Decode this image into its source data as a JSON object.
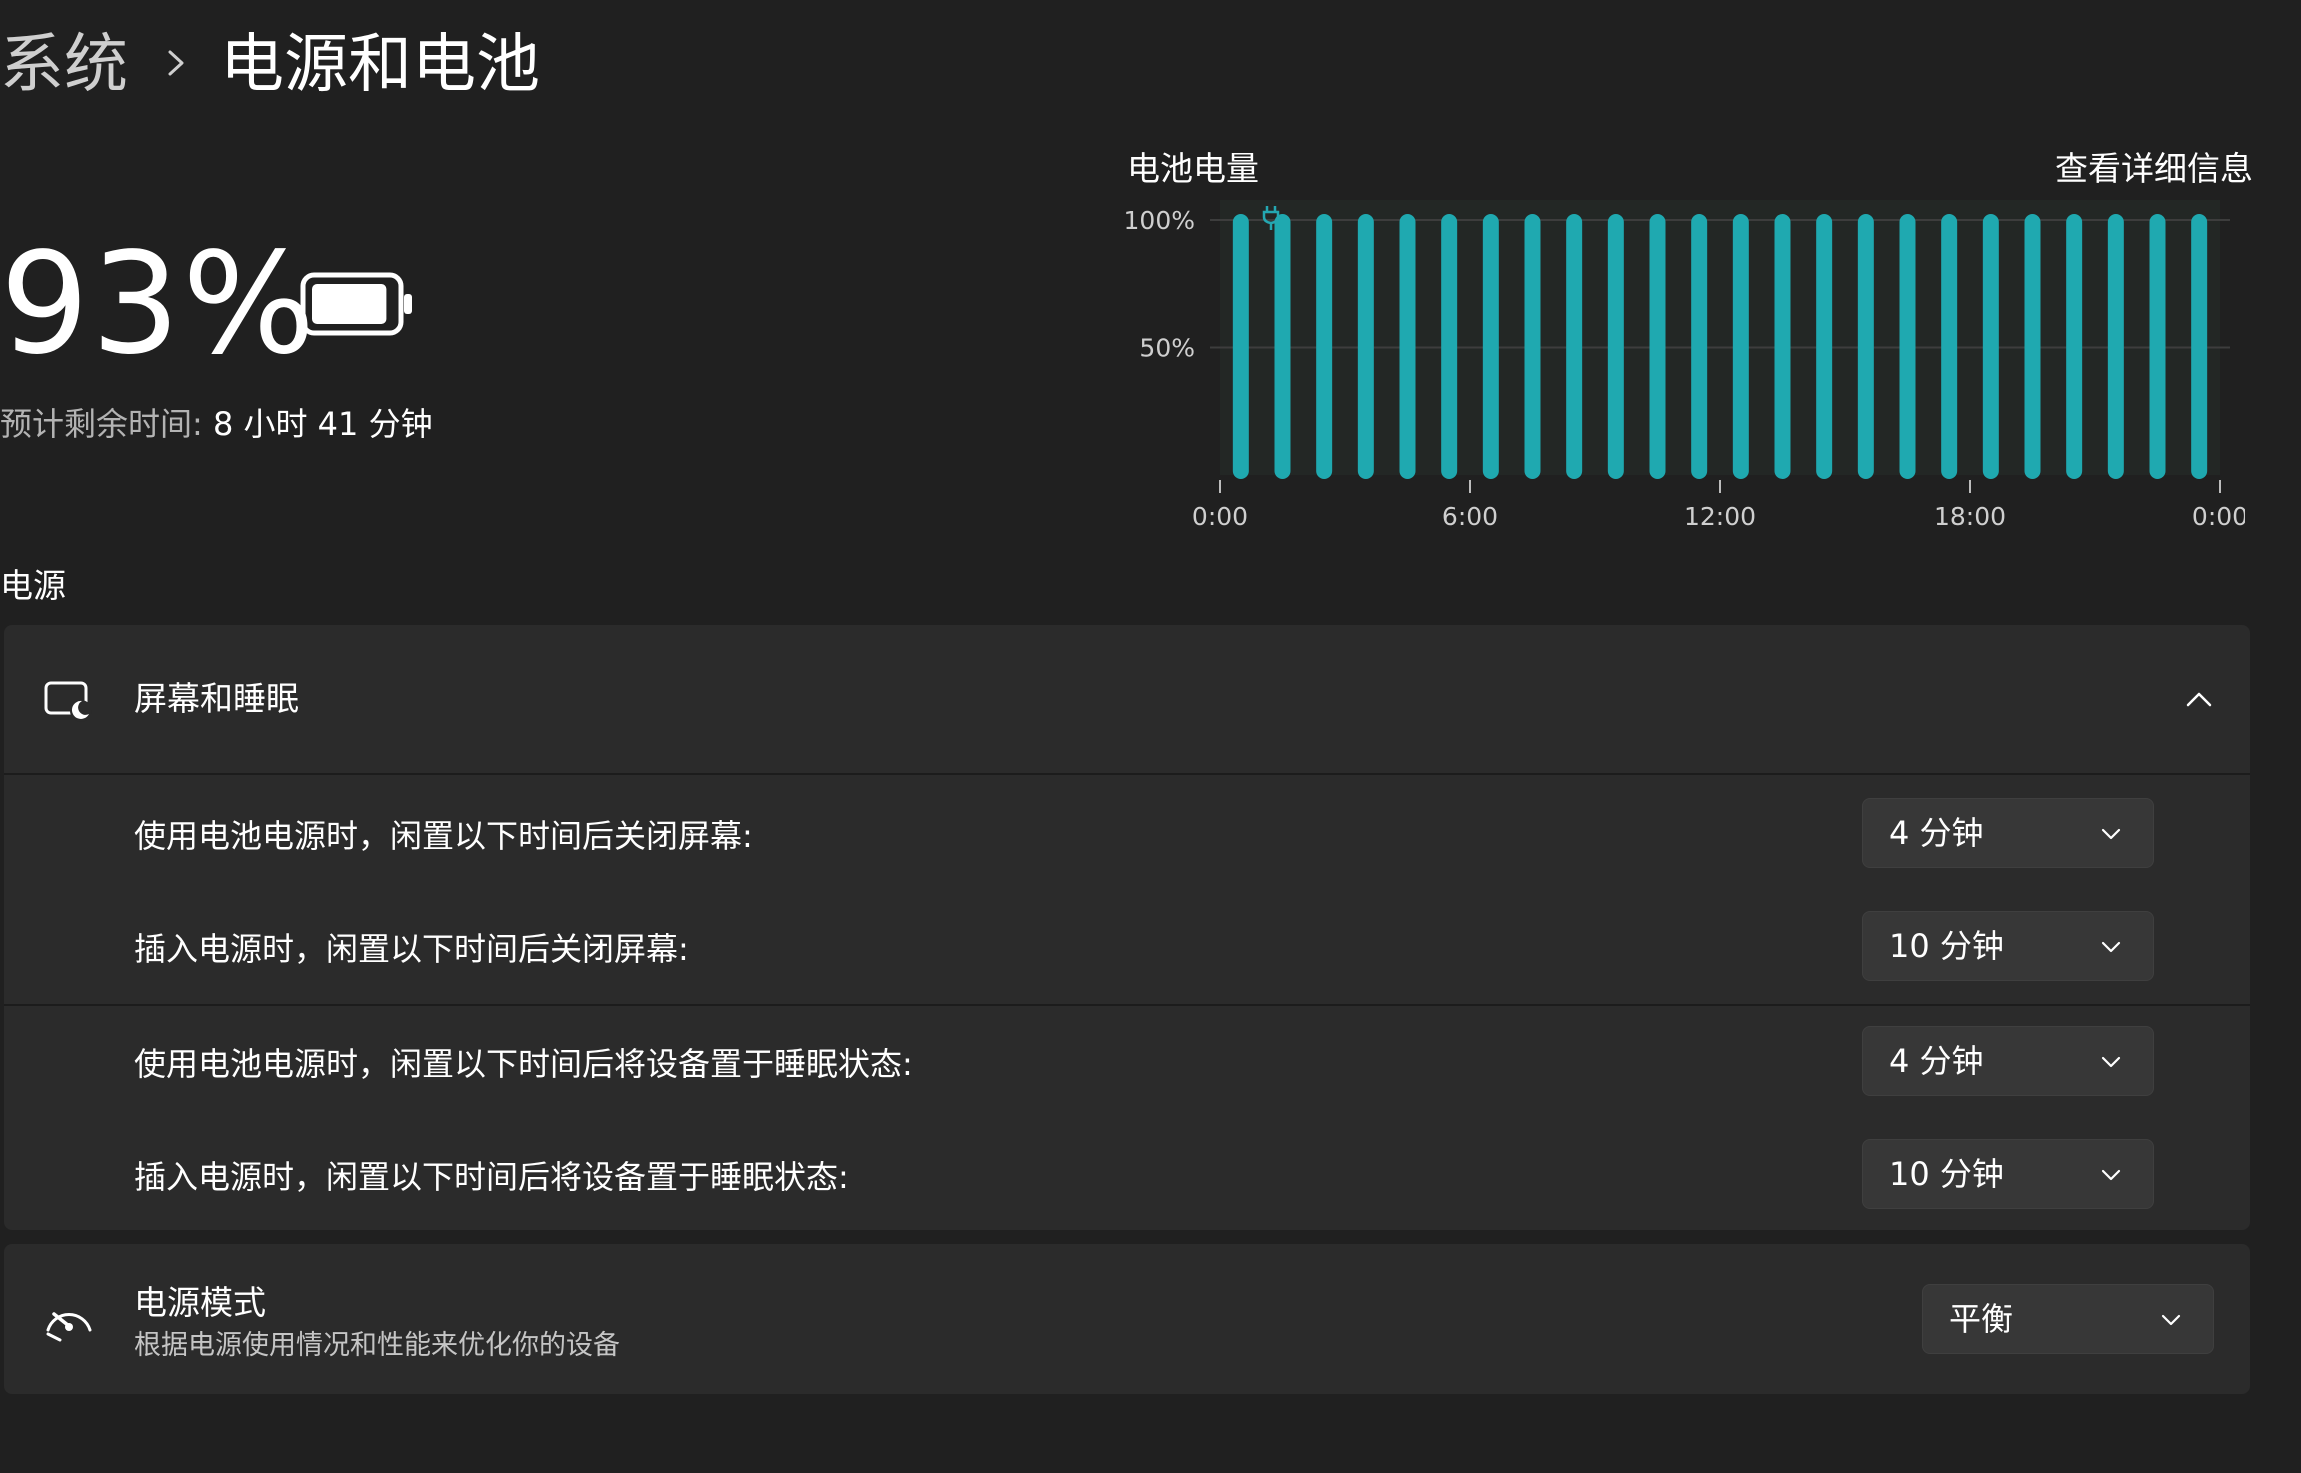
{
  "breadcrumb": {
    "parent": "系统",
    "current": "电源和电池"
  },
  "battery": {
    "percent_text": "93%",
    "level": 0.93,
    "remaining_label": "预计剩余时间:",
    "remaining_value": " 8 小时 41 分钟"
  },
  "chart_section": {
    "title": "电池电量",
    "details_link": "查看详细信息"
  },
  "chart_data": {
    "type": "bar",
    "ylim": [
      0,
      100
    ],
    "yticks": [
      "100%",
      "50%"
    ],
    "xticks": [
      "0:00",
      "6:00",
      "12:00",
      "18:00",
      "0:00"
    ],
    "values": [
      100,
      100,
      100,
      100,
      100,
      100,
      100,
      100,
      100,
      100,
      100,
      100,
      100,
      100,
      100,
      100,
      100,
      100,
      100,
      100,
      100,
      100,
      100,
      100
    ],
    "bar_color": "#1fa9b0",
    "grid": true,
    "plugged_in_marker": "plug-icon"
  },
  "section_label": "电源",
  "screen_sleep": {
    "title": "屏幕和睡眠",
    "rows": [
      {
        "label": "使用电池电源时，闲置以下时间后关闭屏幕:",
        "value": "4 分钟"
      },
      {
        "label": "插入电源时，闲置以下时间后关闭屏幕:",
        "value": "10 分钟"
      },
      {
        "label": "使用电池电源时，闲置以下时间后将设备置于睡眠状态:",
        "value": "4 分钟"
      },
      {
        "label": "插入电源时，闲置以下时间后将设备置于睡眠状态:",
        "value": "10 分钟"
      }
    ]
  },
  "power_mode": {
    "title": "电源模式",
    "description": "根据电源使用情况和性能来优化你的设备",
    "value": "平衡"
  }
}
